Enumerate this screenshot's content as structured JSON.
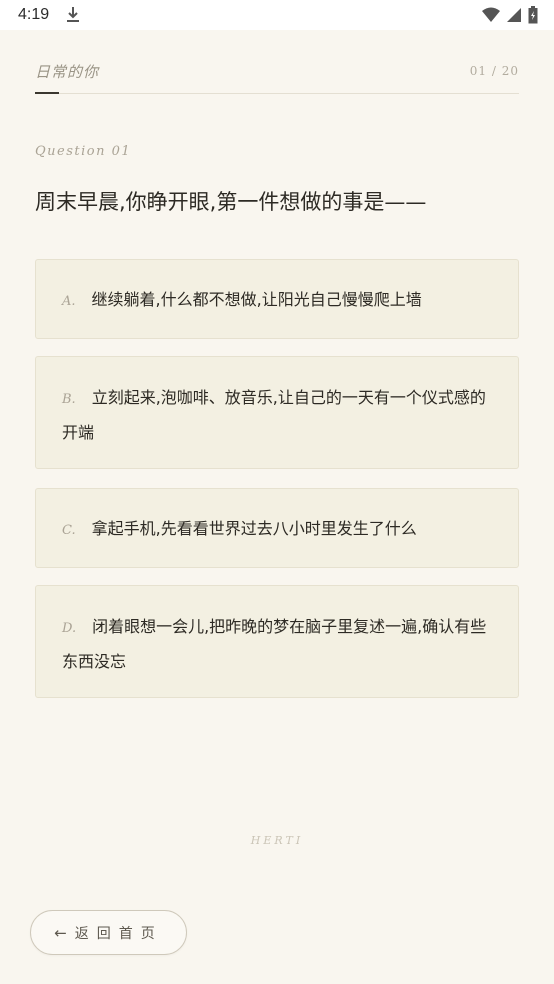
{
  "status_bar": {
    "time": "4:19"
  },
  "header": {
    "title": "日常的你",
    "progress": "01 / 20"
  },
  "question": {
    "label": "Question 01",
    "text": "周末早晨,你睁开眼,第一件想做的事是——"
  },
  "options": [
    {
      "letter": "A.",
      "text": "继续躺着,什么都不想做,让阳光自己慢慢爬上墙"
    },
    {
      "letter": "B.",
      "text": "立刻起来,泡咖啡、放音乐,让自己的一天有一个仪式感的开端"
    },
    {
      "letter": "C.",
      "text": "拿起手机,先看看世界过去八小时里发生了什么"
    },
    {
      "letter": "D.",
      "text": "闭着眼想一会儿,把昨晚的梦在脑子里复述一遍,确认有些东西没忘"
    }
  ],
  "brand": "HERTI",
  "back_button": {
    "arrow": "←",
    "label": "返回首页"
  },
  "icons": {
    "download": "download-icon",
    "wifi": "wifi-icon",
    "signal": "signal-icon",
    "battery": "battery-icon"
  },
  "colors": {
    "background": "#f9f6ef",
    "option_background": "#f3f0e2",
    "text": "#2d2a24",
    "muted": "#aaa395"
  }
}
